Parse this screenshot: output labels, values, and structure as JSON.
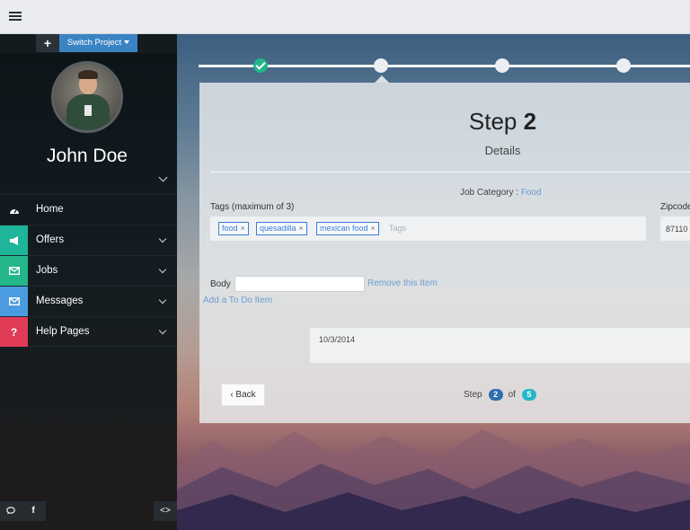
{
  "topbar": {
    "menu_icon": "list-icon"
  },
  "sidebar": {
    "switch_project_label": "Switch Project",
    "plus_label": "+",
    "user_name": "John Doe",
    "nav": [
      {
        "label": "Home",
        "icon": "dashboard-icon",
        "color": "",
        "has_chevron": false
      },
      {
        "label": "Offers",
        "icon": "megaphone-icon",
        "color": "#1fb59a",
        "has_chevron": true
      },
      {
        "label": "Jobs",
        "icon": "envelope-icon",
        "color": "#24b78c",
        "has_chevron": true
      },
      {
        "label": "Messages",
        "icon": "envelope-icon",
        "color": "#4a9be0",
        "has_chevron": true
      },
      {
        "label": "Help Pages",
        "icon": "question-icon",
        "color": "#e03b57",
        "has_chevron": true
      }
    ],
    "bottom": {
      "chat_icon": "chat-icon",
      "facebook_label": "f",
      "code_label": "<>"
    }
  },
  "wizard": {
    "step_word": "Step",
    "step_number": "2",
    "subtitle": "Details",
    "job_category_label": "Job Category :",
    "job_category_value": "Food",
    "tags_label": "Tags (maximum of 3)",
    "tags": [
      "food",
      "quesadilla",
      "mexican food"
    ],
    "tags_placeholder": "Tags",
    "zipcode_label": "Zipcode",
    "zipcode_value": "87110",
    "body_label": "Body",
    "remove_item": "Remove this Item",
    "add_item": "Add a To Do Item",
    "date_value": "10/3/2014",
    "back_label": "‹ Back",
    "step_label": "Step",
    "of_label": "of",
    "current_step": "2",
    "total_steps": "5",
    "steps_done": [
      true,
      false,
      false,
      false
    ]
  },
  "colors": {
    "accent_blue": "#3a84c4",
    "success_green": "#23b48a",
    "link_blue": "#6e9ed0"
  }
}
